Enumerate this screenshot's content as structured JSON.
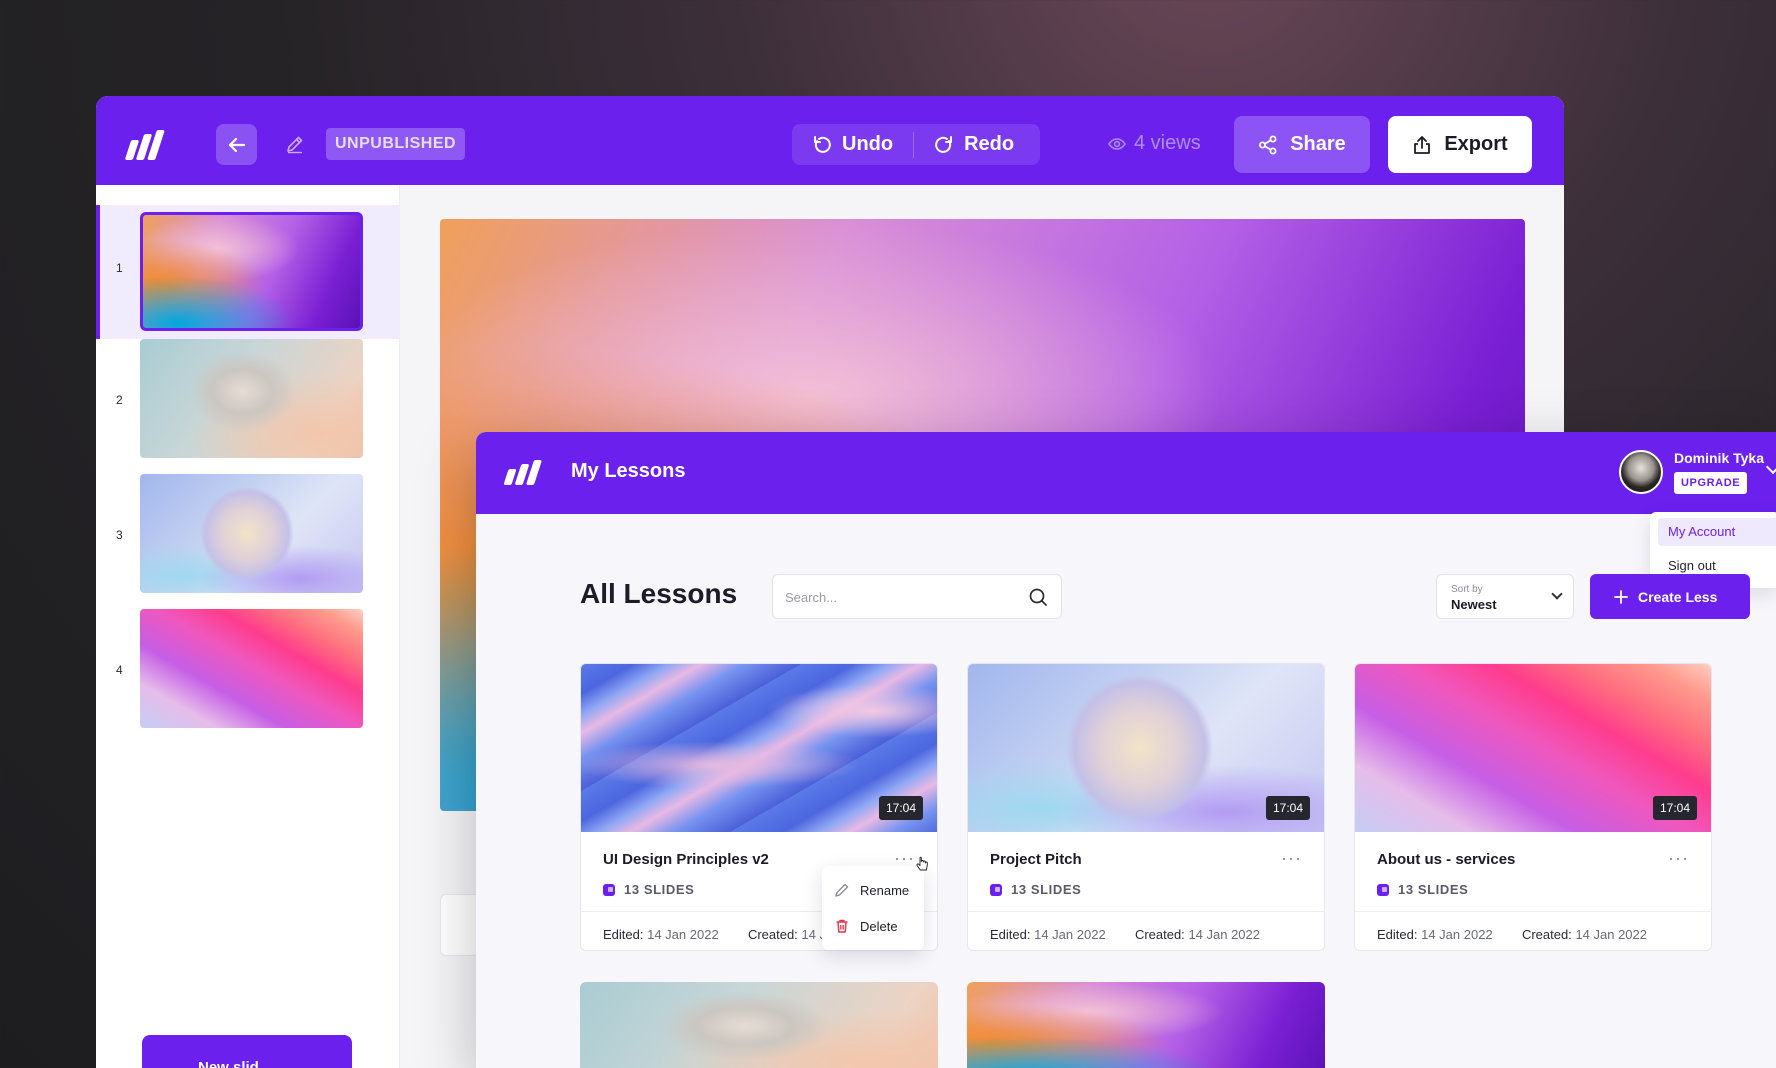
{
  "editor": {
    "status_badge": "UNPUBLISHED",
    "undo_label": "Undo",
    "redo_label": "Redo",
    "views_label": "4 views",
    "share_label": "Share",
    "export_label": "Export",
    "slides": [
      {
        "number": "1"
      },
      {
        "number": "2"
      },
      {
        "number": "3"
      },
      {
        "number": "4"
      }
    ],
    "new_slide_label": "New slid"
  },
  "lessons": {
    "app_title": "My Lessons",
    "user": {
      "name": "Dominik Tyka",
      "plan_badge": "UPGRADE",
      "menu": [
        "My Account",
        "Sign out"
      ]
    },
    "page_title": "All Lessons",
    "search_placeholder": "Search...",
    "sort": {
      "label": "Sort by",
      "value": "Newest"
    },
    "create_label": "Create Less",
    "edited_label": "Edited:",
    "created_label": "Created:",
    "cards": [
      {
        "title": "UI Design Principles v2",
        "duration": "17:04",
        "slides": "13 SLIDES",
        "edited": "14 Jan 2022",
        "created": "14 Ja"
      },
      {
        "title": "Project Pitch",
        "duration": "17:04",
        "slides": "13 SLIDES",
        "edited": "14 Jan 2022",
        "created": "14 Jan 2022"
      },
      {
        "title": "About us - services",
        "duration": "17:04",
        "slides": "13 SLIDES",
        "edited": "14 Jan 2022",
        "created": "14 Jan 2022"
      }
    ],
    "context_menu": {
      "rename": "Rename",
      "delete": "Delete"
    }
  },
  "colors": {
    "brand": "#6b20ee",
    "danger": "#e5384f"
  }
}
